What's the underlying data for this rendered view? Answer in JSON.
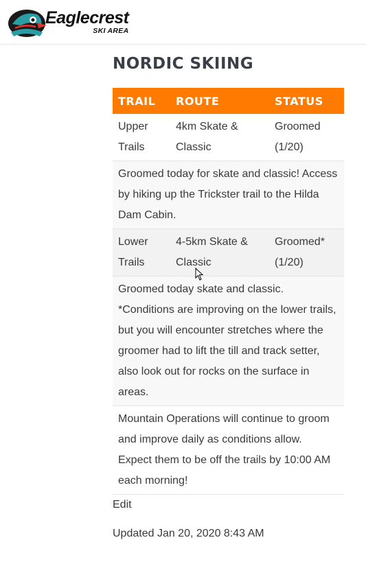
{
  "header": {
    "logo_name": "Eaglecrest",
    "logo_sub": "SKI AREA"
  },
  "section": {
    "title": "NORDIC SKIING"
  },
  "table": {
    "headers": [
      "TRAIL",
      "ROUTE",
      "STATUS"
    ],
    "rows": [
      {
        "trail": "Upper Trails",
        "route": "4km Skate & Classic",
        "status": "Groomed (1/20)",
        "note": "Groomed today for skate and classic! Access by hiking up the Trickster trail to the Hilda Dam Cabin."
      },
      {
        "trail": "Lower Trails",
        "route": "4-5km Skate & Classic",
        "status": "Groomed* (1/20)",
        "note": "Groomed today skate and classic. *Conditions are improving on the lower trails, but you will encounter stretches where the groomer had to lift the till and track setter, also look out for rocks on the surface in areas."
      }
    ],
    "footer_note": "Mountain Operations will continue to groom and improve daily as conditions allow. Expect them to be off the trails by 10:00 AM each morning!"
  },
  "edit_label": "Edit",
  "updated_text": "Updated Jan 20, 2020 8:43 AM",
  "colors": {
    "header_bg": "#ff7a00",
    "title": "#3b4048"
  }
}
